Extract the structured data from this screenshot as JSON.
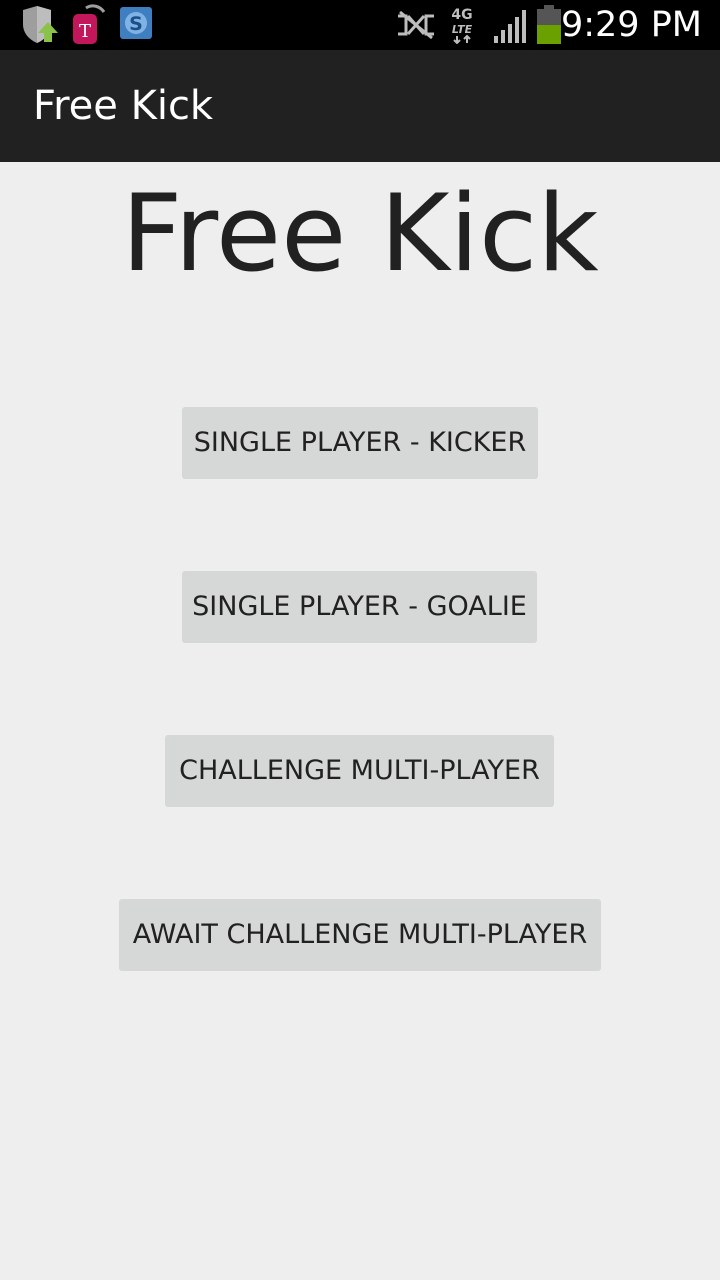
{
  "status_bar": {
    "time": "9:29 PM",
    "network_label": "4G LTE",
    "icons": [
      "shield-update-icon",
      "tmobile-tag-icon",
      "skype-icon",
      "nfc-off-icon",
      "4g-lte-icon",
      "signal-icon",
      "battery-icon"
    ]
  },
  "action_bar": {
    "title": "Free Kick"
  },
  "main": {
    "title": "Free Kick",
    "buttons": [
      {
        "label": "SINGLE PLAYER - KICKER"
      },
      {
        "label": "SINGLE PLAYER - GOALIE"
      },
      {
        "label": "CHALLENGE MULTI-PLAYER"
      },
      {
        "label": "AWAIT CHALLENGE MULTI-PLAYER"
      }
    ]
  },
  "colors": {
    "status_bar": "#000000",
    "action_bar": "#212121",
    "background": "#eeeeee",
    "button": "#d6d7d7",
    "text": "#212121",
    "battery_fill": "#6aa000"
  }
}
